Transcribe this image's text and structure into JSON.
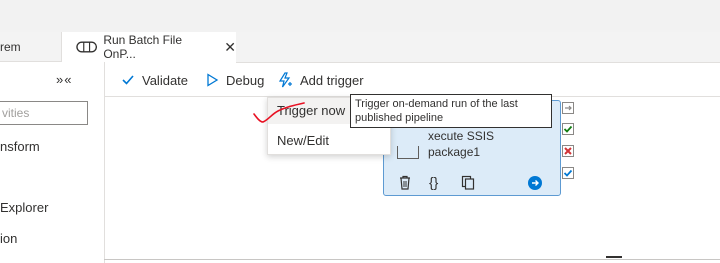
{
  "tabs": [
    {
      "label": "rem"
    },
    {
      "label": "Run Batch File OnP...",
      "close": "✕"
    }
  ],
  "sidebar": {
    "collapse_glyph": "»«",
    "search_placeholder": "vities",
    "items": [
      {
        "label": "nsform"
      },
      {
        "label": "Explorer"
      },
      {
        "label": "ion"
      }
    ]
  },
  "toolbar": {
    "validate_label": "Validate",
    "debug_label": "Debug",
    "add_trigger_label": "Add trigger"
  },
  "trigger_menu": {
    "items": [
      {
        "label": "Trigger now"
      },
      {
        "label": "New/Edit"
      }
    ],
    "tooltip": "Trigger on-demand run of the last published pipeline"
  },
  "activity": {
    "name_line1": "xecute SSIS",
    "name_line2": "package1",
    "actions": {
      "code": "{}"
    }
  },
  "colors": {
    "accent": "#0078d4",
    "card_bg": "#dcebf8",
    "card_border": "#5d9ad2",
    "success": "#107c10",
    "failure": "#d13438",
    "annotation": "#e81123"
  }
}
